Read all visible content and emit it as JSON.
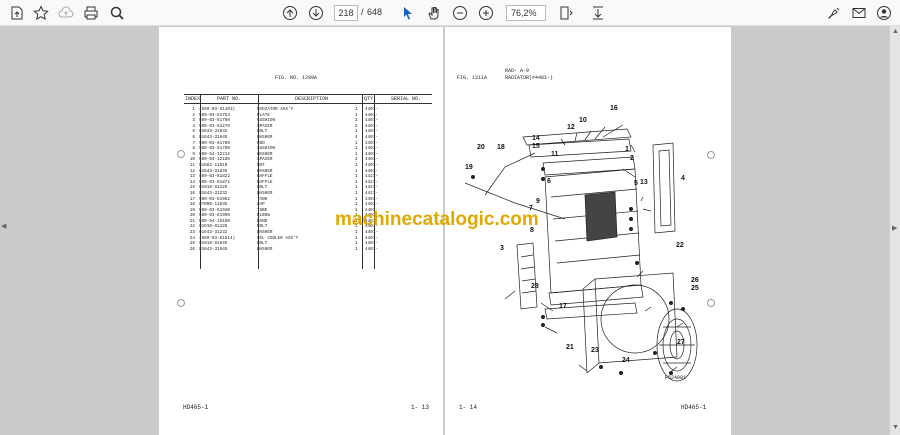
{
  "toolbar": {
    "current_page": "218",
    "page_separator": "/",
    "total_pages": "648",
    "zoom": "76,2%"
  },
  "left_page": {
    "fig_no": "FIG. NO.   1209A",
    "columns": [
      "INDEX",
      "PART NO.",
      "DESCRIPTION",
      "QTY",
      "SERIAL NO."
    ],
    "rows": [
      [
        "1",
        "(569-03-61103)",
        "RADIATOR ASS'Y",
        "1",
        "4401-"
      ],
      [
        "2",
        "569-03-51753",
        "PLATE",
        "1",
        "4401-"
      ],
      [
        "3",
        "569-03-61760",
        "CUSHION",
        "2",
        "4401-"
      ],
      [
        "4",
        "569-03-62270",
        "SPACER",
        "2",
        "4401-"
      ],
      [
        "5",
        "01643-31032",
        "BOLT",
        "1",
        "4401-"
      ],
      [
        "6",
        "01643-31645",
        "WASHER",
        "4",
        "4401-"
      ],
      [
        "7",
        "569-03-61780",
        "ROD",
        "1",
        "4401-"
      ],
      [
        "8",
        "569-03-61790",
        "CUSHION",
        "1",
        "4401-"
      ],
      [
        "9",
        "569-54-12212",
        "WASHER",
        "1",
        "4401-"
      ],
      [
        "10",
        "569-03-12180",
        "SPACER",
        "2",
        "4401-"
      ],
      [
        "11",
        "01582-11810",
        "NUT",
        "1",
        "4401-"
      ],
      [
        "12",
        "01643-31845",
        "WASHER",
        "1",
        "4401-"
      ],
      [
        "13",
        "569-03-61822",
        "BAFFLE",
        "1",
        "4427-"
      ],
      [
        "14",
        "569-03-61872",
        "BAFFLE",
        "1",
        "4427-"
      ],
      [
        "15",
        "01010-81225",
        "BOLT",
        "1",
        "4427-"
      ],
      [
        "16",
        "01643-31232",
        "WASHER",
        "1",
        "4427-"
      ],
      [
        "17",
        "569-03-61952",
        "TANK",
        "1",
        "4401-"
      ],
      [
        "18",
        "07000-11035",
        "CAP",
        "1",
        "4401-"
      ],
      [
        "19",
        "569-03-61940",
        "TUBE",
        "1",
        "4401-"
      ],
      [
        "20",
        "569-03-61950",
        "ELBOW",
        "1",
        "4401-"
      ],
      [
        "21",
        "569-54-18180",
        "BAND",
        "1",
        "4401-"
      ],
      [
        "22",
        "01010-81225",
        "BOLT",
        "1",
        "4401-"
      ],
      [
        "23",
        "01643-31232",
        "WASHER",
        "1",
        "4401-"
      ],
      [
        "24",
        "(569-03-61514)",
        "OIL COOLER ASS'Y",
        "1",
        "4401-"
      ],
      [
        "25",
        "01010-81645",
        "BOLT",
        "1",
        "4401-"
      ],
      [
        "26",
        "01643-31645",
        "WASHER",
        "1",
        "4401-"
      ]
    ],
    "footer_left": "HD465-1",
    "footer_right": "1- 13"
  },
  "right_page": {
    "fig_no": "FIG. 1211A",
    "group_line1": "RAD- A-9",
    "group_line2": "RADIATOR(#4401-)",
    "figure_code": "F524081",
    "footer_left": "1- 14",
    "footer_right": "HD465-1",
    "callouts": [
      "1",
      "2",
      "3",
      "4",
      "5",
      "6",
      "7",
      "8",
      "9",
      "10",
      "11",
      "12",
      "13",
      "14",
      "15",
      "16",
      "17",
      "18",
      "19",
      "20",
      "21",
      "22",
      "23",
      "24",
      "25",
      "26",
      "27",
      "28"
    ]
  },
  "watermark": "machinecatalogic.com"
}
